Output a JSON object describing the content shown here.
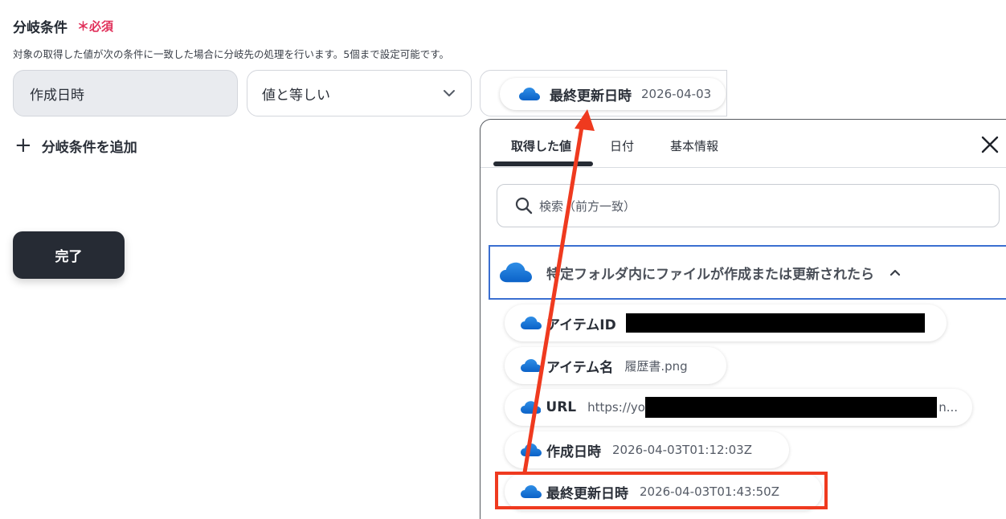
{
  "section": {
    "title": "分岐条件",
    "required_mark": "＊必須",
    "description": "対象の取得した値が次の条件に一致した場合に分岐先の処理を行います。5個まで設定可能です。"
  },
  "condition": {
    "field": "作成日時",
    "operator": "値と等しい",
    "value_chip_label": "最終更新日時",
    "value_chip_value": "2026-04-03"
  },
  "add_condition_label": "分岐条件を追加",
  "done_button": "完了",
  "panel": {
    "tabs": [
      "取得した値",
      "日付",
      "基本情報"
    ],
    "active_tab": "取得した値",
    "search_placeholder": "検索（前方一致）",
    "group_title": "特定フォルダ内にファイルが作成または更新されたら",
    "items": [
      {
        "label": "アイテムID",
        "value": ""
      },
      {
        "label": "アイテム名",
        "value": "履歴書.png"
      },
      {
        "label": "URL",
        "value_prefix": "https://yo",
        "value_suffix": "n..."
      },
      {
        "label": "作成日時",
        "value": "2026-04-03T01:12:03Z"
      },
      {
        "label": "最終更新日時",
        "value": "2026-04-03T01:43:50Z"
      }
    ]
  },
  "colors": {
    "accent_red": "#ef3a1f",
    "required_pink": "#e0305a",
    "dark_button": "#262b34",
    "focus_blue": "#3b6fd1"
  }
}
